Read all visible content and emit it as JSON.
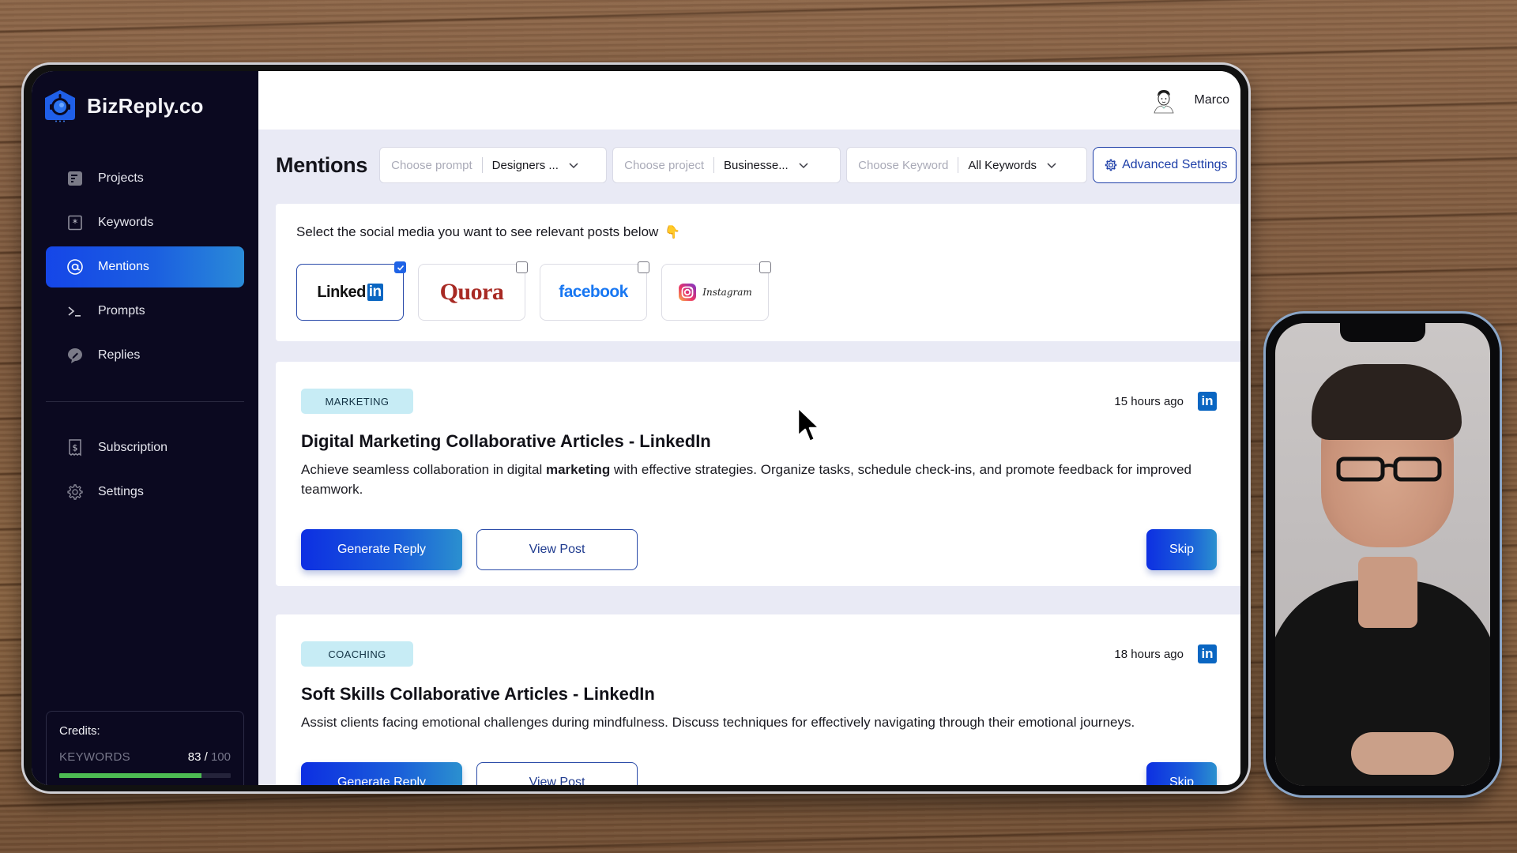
{
  "app": {
    "brand_name": "BizReply.co",
    "accent_color": "#1546e8",
    "sidebar_color": "#0b0920"
  },
  "sidebar": {
    "items": [
      {
        "label": "Projects",
        "icon": "document-list-icon",
        "active": false
      },
      {
        "label": "Keywords",
        "icon": "asterisk-box-icon",
        "active": false
      },
      {
        "label": "Mentions",
        "icon": "at-sign-icon",
        "active": true
      },
      {
        "label": "Prompts",
        "icon": "terminal-prompt-icon",
        "active": false
      },
      {
        "label": "Replies",
        "icon": "chat-pencil-icon",
        "active": false
      }
    ],
    "secondary_items": [
      {
        "label": "Subscription",
        "icon": "receipt-dollar-icon"
      },
      {
        "label": "Settings",
        "icon": "gear-icon"
      }
    ],
    "credits": {
      "title": "Credits:",
      "label": "KEYWORDS",
      "used": "83",
      "separator": "/",
      "total": "100",
      "fraction": 0.83,
      "bar_color": "#4cbb52"
    }
  },
  "topbar": {
    "user_name": "Marco"
  },
  "main": {
    "page_title": "Mentions",
    "filters": [
      {
        "placeholder": "Choose prompt",
        "value": "Designers ..."
      },
      {
        "placeholder": "Choose project",
        "value": "Businesse..."
      },
      {
        "placeholder": "Choose Keyword",
        "value": "All Keywords"
      }
    ],
    "advanced_settings_label": "Advanced Settings",
    "social": {
      "prompt": "Select the social media you want to see relevant posts below",
      "prompt_emoji": "👇",
      "options": [
        {
          "name": "LinkedIn",
          "logo_text_1": "Linked",
          "logo_text_2": "in",
          "selected": true
        },
        {
          "name": "Quora",
          "logo_text": "Quora",
          "selected": false
        },
        {
          "name": "facebook",
          "logo_text": "facebook",
          "selected": false
        },
        {
          "name": "Instagram",
          "logo_text": "Instagram",
          "selected": false
        }
      ]
    },
    "posts": [
      {
        "tag": "MARKETING",
        "time": "15 hours ago",
        "platform_icon": "linkedin-icon",
        "title_pre": "Digital ",
        "title_bold": "Marketing",
        "title_post": " Collaborative Articles - LinkedIn",
        "body_pre": "Achieve seamless collaboration in digital ",
        "body_bold": "marketing",
        "body_post": " with effective strategies. Organize tasks, schedule check-ins, and promote feedback for improved teamwork.",
        "generate_label": "Generate Reply",
        "view_label": "View Post",
        "skip_label": "Skip"
      },
      {
        "tag": "COACHING",
        "time": "18 hours ago",
        "platform_icon": "linkedin-icon",
        "title_pre": "Soft Skills Collaborative Articles - LinkedIn",
        "title_bold": "",
        "title_post": "",
        "body_pre": "Assist clients facing emotional challenges during mindfulness. Discuss techniques for effectively navigating through their emotional journeys.",
        "body_bold": "",
        "body_post": "",
        "generate_label": "Generate Reply",
        "view_label": "View Post",
        "skip_label": "Skip"
      }
    ],
    "linkedin_badge_text": "in"
  }
}
